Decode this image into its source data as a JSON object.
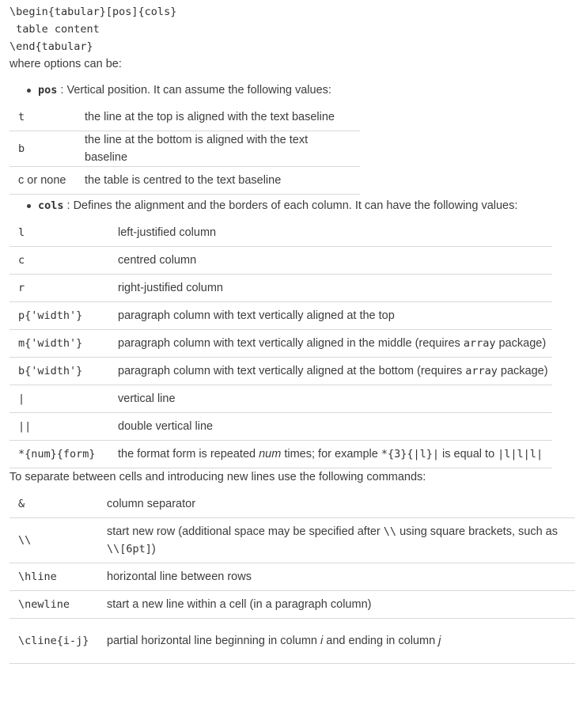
{
  "code_block": {
    "line1": "\\begin{tabular}[pos]{cols}",
    "line2": " table content",
    "line3": "\\end{tabular}"
  },
  "intro": "where options can be:",
  "pos_bullet": {
    "term": "pos",
    "text": ": Vertical position. It can assume the following values:"
  },
  "pos_table": [
    {
      "code": "t",
      "desc": "the line at the top is aligned with the text baseline"
    },
    {
      "code": "b",
      "desc": "the line at the bottom is aligned with the text baseline"
    },
    {
      "code": "c or none",
      "desc": "the table is centred to the text baseline"
    }
  ],
  "cols_bullet": {
    "term": "cols",
    "text": ": Defines the alignment and the borders of each column. It can have the following values:"
  },
  "cols_table": {
    "rows": [
      {
        "code": "l",
        "desc": "left-justified column"
      },
      {
        "code": "c",
        "desc": "centred column"
      },
      {
        "code": "r",
        "desc": "right-justified column"
      },
      {
        "code": "p{'width'}",
        "desc": "paragraph column with text vertically aligned at the top"
      }
    ],
    "m_row": {
      "code": "m{'width'}",
      "desc_a": "paragraph column with text vertically aligned in the middle (requires ",
      "desc_code": "array",
      "desc_b": " package)"
    },
    "b_row": {
      "code": "b{'width'}",
      "desc_a": "paragraph column with text vertically aligned at the bottom (requires ",
      "desc_code": "array",
      "desc_b": " package)"
    },
    "rows2": [
      {
        "code": "|",
        "desc": "vertical line"
      },
      {
        "code": "||",
        "desc": "double vertical line"
      }
    ],
    "num_row": {
      "code": "*{num}{form}",
      "desc_a": "the format form is repeated ",
      "desc_em": "num",
      "desc_b": " times; for example ",
      "desc_code1": "*{3}{|l}|",
      "desc_c": " is equal to ",
      "desc_code2": "|l|l|l|"
    }
  },
  "separator_text": "To separate between cells and introducing new lines use the following commands:",
  "cmd_table": {
    "amp": {
      "code": "&",
      "desc": "column separator"
    },
    "newrow": {
      "code": "\\\\",
      "desc_a": "start new row (additional space may be specified after ",
      "desc_code1": "\\\\",
      "desc_b": " using square brackets, such as ",
      "desc_code2": "\\\\[6pt]",
      "desc_c": ")"
    },
    "hline": {
      "code": "\\hline",
      "desc": "horizontal line between rows"
    },
    "newline": {
      "code": "\\newline",
      "desc": "start a new line within a cell (in a paragraph column)"
    },
    "cline": {
      "code": "\\cline{i-j}",
      "desc_a": "partial horizontal line beginning in column ",
      "desc_em1": "i",
      "desc_b": " and ending in column ",
      "desc_em2": "j"
    }
  }
}
